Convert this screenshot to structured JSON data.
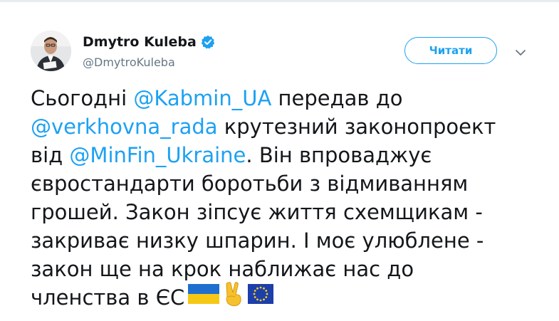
{
  "tweet": {
    "author": {
      "name": "Dmytro Kuleba",
      "handle": "@DmytroKuleba",
      "verified": true,
      "avatar_icon": "profile-photo"
    },
    "follow_button_label": "Читати",
    "menu_icon": "chevron-down-icon",
    "text": {
      "line1_part1": "Сьогодні ",
      "mention_kabmin": "@Kabmin_UA",
      "line1_part2": " передав до",
      "mention_rada": "@verkhovna_rada",
      "line2_part1": " крутезний законопроект",
      "line3_part1": "від ",
      "mention_minfin": "@MinFin_Ukraine",
      "line3_part2": ". Він впроваджує",
      "line4": "євростандарти боротьби з відмиванням",
      "line5": "грошей. Закон зіпсує життя схемщикам -",
      "line6": "закриває низку шпарин. І моє улюблене -",
      "line7": "закон ще на крок наближає нас до",
      "line8_part1": "членства в ЄС"
    },
    "emojis": [
      "ukraine-flag-icon",
      "victory-hand-icon",
      "eu-flag-icon"
    ],
    "colors": {
      "accent": "#1da1f2",
      "text": "#14171a",
      "secondary_text": "#657786"
    }
  }
}
